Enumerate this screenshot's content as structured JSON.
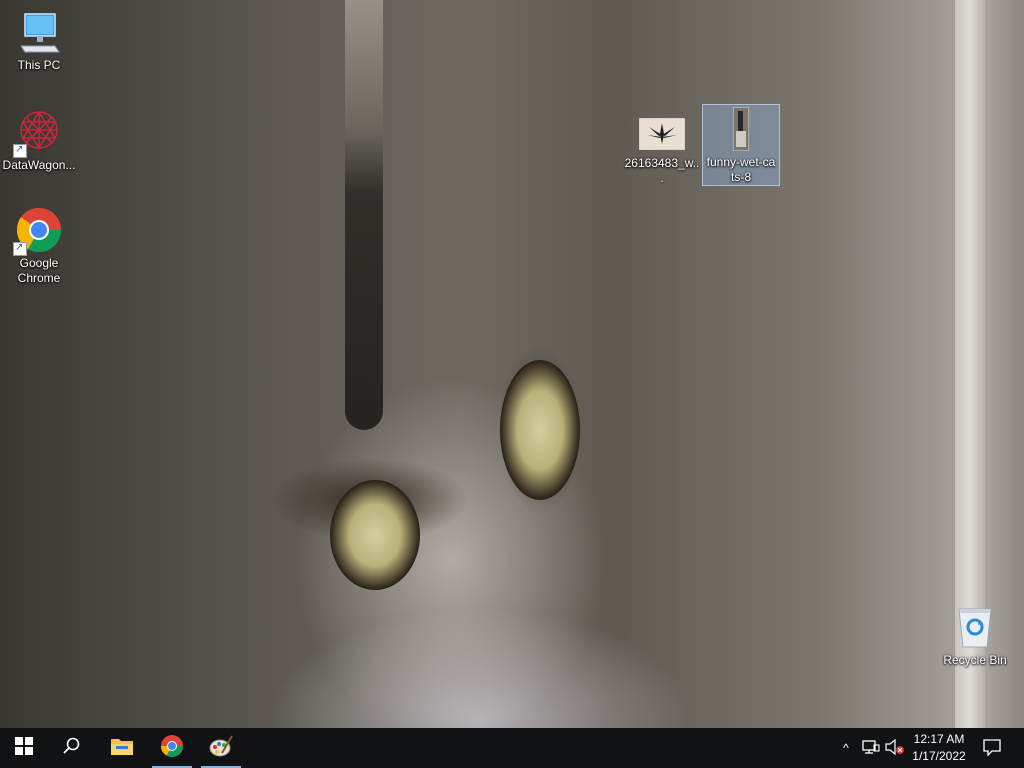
{
  "desktop": {
    "icons": [
      {
        "label": "This PC",
        "icon": "this-pc-icon"
      },
      {
        "label": "DataWagon...",
        "icon": "datawagon-icon"
      },
      {
        "label": "Google Chrome",
        "icon": "chrome-icon"
      },
      {
        "label": "26163483_w...",
        "icon": "image-file-icon"
      },
      {
        "label": "funny-wet-ca ts-8",
        "icon": "image-file-icon"
      },
      {
        "label": "Recycle Bin",
        "icon": "recycle-bin-icon"
      }
    ]
  },
  "taskbar": {
    "start": "start-icon",
    "search": "search-icon",
    "pinned": [
      "file-explorer-icon",
      "chrome-icon",
      "paint-icon"
    ],
    "tray": {
      "chevron": "^",
      "network": "network-icon",
      "volume": "volume-muted-icon"
    },
    "clock": {
      "time": "12:17 AM",
      "date": "1/17/2022"
    },
    "accent": "#7fb4e8"
  }
}
